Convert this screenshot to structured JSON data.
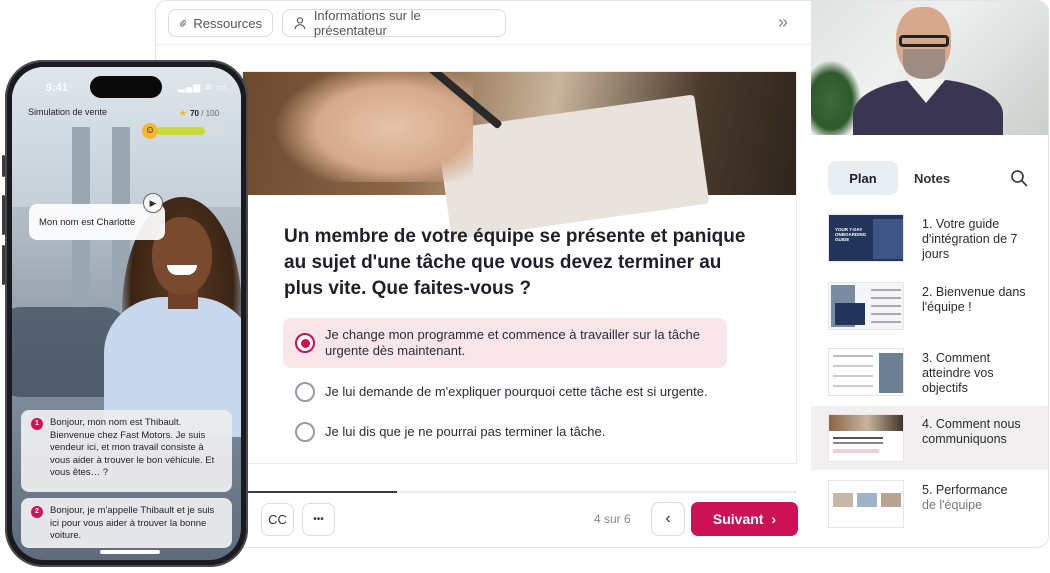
{
  "topbar": {
    "resources_label": "Ressources",
    "presenter_label": "Informations sur le présentateur",
    "collapse_glyph": "»"
  },
  "slide": {
    "question": "Un membre de votre équipe se présente et panique au sujet d'une tâche que vous devez terminer au plus vite. Que faites-vous ?",
    "options": [
      {
        "label": "Je change mon programme et commence à travailler sur la tâche urgente dès maintenant.",
        "selected": true
      },
      {
        "label": "Je lui demande de m'expliquer pourquoi cette tâche est si urgente.",
        "selected": false
      },
      {
        "label": "Je lui dis que je ne pourrai pas terminer la tâche.",
        "selected": false
      }
    ]
  },
  "player": {
    "cc_label": "CC",
    "more_label": "•••",
    "page_count": "4 sur 6",
    "prev_glyph": "‹",
    "next_label": "Suivant",
    "next_glyph": "›",
    "progress_fraction": 0.28
  },
  "sidebar": {
    "tabs": [
      {
        "label": "Plan",
        "active": true
      },
      {
        "label": "Notes",
        "active": false
      }
    ],
    "chapters": [
      {
        "label": "1. Votre guide d'intégration de 7 jours",
        "thumb_text": "YOUR 7-DAY ONBOARDING GUIDE",
        "active": false
      },
      {
        "label": "2. Bienvenue dans l'équipe !",
        "thumb_text": "",
        "active": false
      },
      {
        "label": "3. Comment atteindre vos objectifs",
        "thumb_text": "",
        "active": false
      },
      {
        "label": "4. Comment nous communiquons",
        "thumb_text": "",
        "active": true
      },
      {
        "label": "5. Performance",
        "label_muted": "de l'équipe",
        "thumb_text": "",
        "active": false
      }
    ]
  },
  "phone": {
    "time": "9:41",
    "status_icons": "▂▄▆ ≋ ▭",
    "sim_title": "Simulation de vente",
    "score_value": "70",
    "score_max": "/ 100",
    "score_fraction": 0.7,
    "name_bubble": "Mon nom est Charlotte",
    "play_glyph": "▶",
    "messages": [
      {
        "num": "1",
        "text": "Bonjour, mon nom est Thibault. Bienvenue chez Fast Motors. Je suis vendeur ici, et mon travail consiste à vous aider à trouver le bon véhicule. Et vous êtes… ?"
      },
      {
        "num": "2",
        "text": "Bonjour, je m'appelle Thibault et je suis ici pour vous aider à trouver la bonne voiture."
      }
    ]
  },
  "colors": {
    "accent": "#cc1154",
    "selected_option_bg": "#f8e6ea",
    "active_chapter_bg": "#f1eff0"
  }
}
